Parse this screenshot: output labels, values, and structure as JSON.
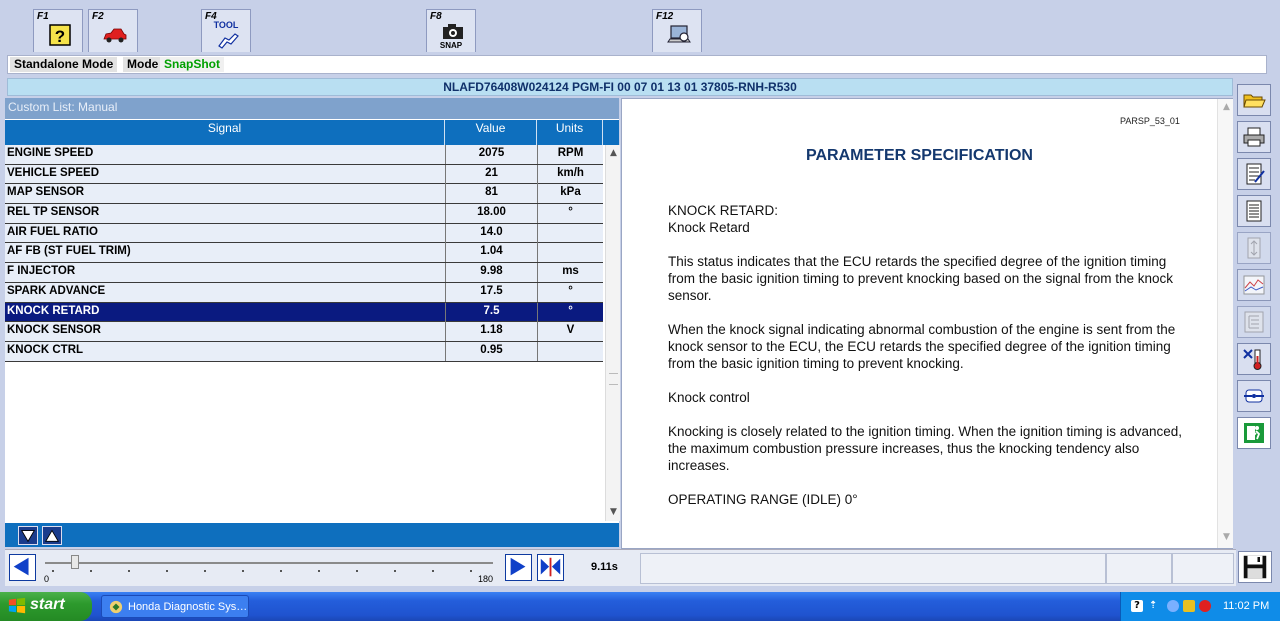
{
  "fkeys": [
    {
      "key": "F1",
      "icon": "help-icon"
    },
    {
      "key": "F2",
      "icon": "car-icon"
    },
    {
      "key": "F4",
      "icon": "tool-icon",
      "text": "TOOL"
    },
    {
      "key": "F8",
      "icon": "camera-icon",
      "text": "SNAP"
    },
    {
      "key": "F12",
      "icon": "laptop-icon"
    }
  ],
  "modes": [
    "Standalone Mode",
    "Mode",
    "SnapShot"
  ],
  "vehicle_info": "NLAFD76408W024124  PGM-FI  00 07 01 13 01  37805-RNH-R530",
  "list": {
    "title": "Custom List: Manual",
    "columns": [
      "Signal",
      "Value",
      "Units"
    ],
    "rows": [
      {
        "signal": "ENGINE SPEED",
        "value": "2075",
        "units": "RPM"
      },
      {
        "signal": "VEHICLE SPEED",
        "value": "21",
        "units": "km/h"
      },
      {
        "signal": "MAP SENSOR",
        "value": "81",
        "units": "kPa"
      },
      {
        "signal": "REL TP SENSOR",
        "value": "18.00",
        "units": "°"
      },
      {
        "signal": "AIR FUEL RATIO",
        "value": "14.0",
        "units": ""
      },
      {
        "signal": "AF FB (ST FUEL TRIM)",
        "value": "1.04",
        "units": ""
      },
      {
        "signal": "F INJECTOR",
        "value": "9.98",
        "units": "ms"
      },
      {
        "signal": "SPARK ADVANCE",
        "value": "17.5",
        "units": "°"
      },
      {
        "signal": "KNOCK RETARD",
        "value": "7.5",
        "units": "°",
        "selected": true
      },
      {
        "signal": "KNOCK SENSOR",
        "value": "1.18",
        "units": "V"
      },
      {
        "signal": "KNOCK CTRL",
        "value": "0.95",
        "units": ""
      }
    ]
  },
  "spec": {
    "code": "PARSP_53_01",
    "title": "PARAMETER SPECIFICATION",
    "heading": "KNOCK RETARD:",
    "subheading": "Knock Retard",
    "paragraphs": [
      "This status indicates that the ECU retards the specified degree of the ignition timing from the basic ignition timing to prevent knocking based on the signal from the knock sensor.",
      "When the knock signal indicating abnormal combustion of the engine is sent from the knock sensor to the ECU, the ECU retards the specified degree of the ignition timing from the basic ignition timing to prevent knocking.",
      "Knock control",
      "Knocking is closely related to the ignition timing. When the ignition timing is advanced, the maximum combustion pressure increases, thus the knocking tendency also increases.",
      "OPERATING RANGE (IDLE) 0°"
    ]
  },
  "timeline": {
    "min_label": "0",
    "max_label": "180",
    "readout": "9.11s",
    "position_value": 9.11
  },
  "right_tools": [
    "open-folder-icon",
    "print-icon",
    "list-edit-icon",
    "document-icon",
    "scroll-icon",
    "graph-icon",
    "tree-icon",
    "thermometer-icon",
    "connect-icon",
    "exit-icon"
  ],
  "taskbar": {
    "start_label": "start",
    "app_label": "Honda Diagnostic Sys…",
    "clock": "11:02 PM"
  },
  "colors": {
    "header_blue": "#0e6fbe",
    "selected_row": "#0a1a80",
    "row_bg": "#e8eef8",
    "title_blue": "#14386e"
  }
}
